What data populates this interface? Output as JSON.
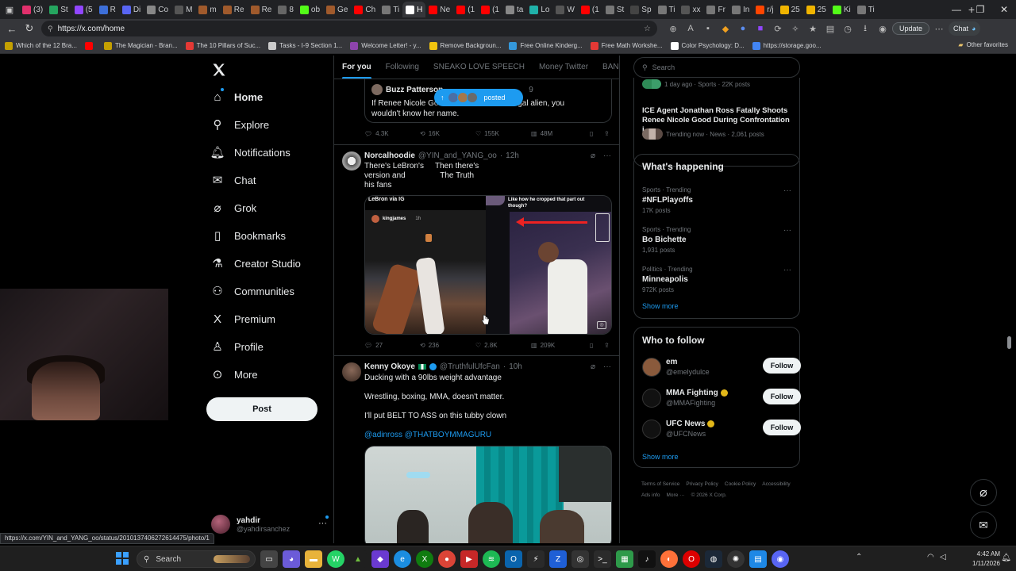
{
  "browser": {
    "tabs": [
      {
        "label": "(3)",
        "color": "#e1306c"
      },
      {
        "label": "St",
        "color": "#25a55f"
      },
      {
        "label": "(5",
        "color": "#9146ff"
      },
      {
        "label": "R",
        "color": "#3d6fd8"
      },
      {
        "label": "Di",
        "color": "#5865f2"
      },
      {
        "label": "Co",
        "color": "#888888"
      },
      {
        "label": "M",
        "color": "#555555"
      },
      {
        "label": "m",
        "color": "#a05a2c"
      },
      {
        "label": "Re",
        "color": "#a05a2c"
      },
      {
        "label": "Re",
        "color": "#a05a2c"
      },
      {
        "label": "8",
        "color": "#666666"
      },
      {
        "label": "ob",
        "color": "#53fc18"
      },
      {
        "label": "Ge",
        "color": "#a05a2c"
      },
      {
        "label": "Ch",
        "color": "#ff0000"
      },
      {
        "label": "Ti",
        "color": "#777777"
      },
      {
        "label": "H",
        "color": "#ffffff"
      },
      {
        "label": "Ne",
        "color": "#ff0000"
      },
      {
        "label": "(1",
        "color": "#ff0000"
      },
      {
        "label": "(1",
        "color": "#ff0000"
      },
      {
        "label": "ta",
        "color": "#888888"
      },
      {
        "label": "Lo",
        "color": "#20b2aa"
      },
      {
        "label": "W",
        "color": "#555555"
      },
      {
        "label": "(1",
        "color": "#ff0000"
      },
      {
        "label": "St",
        "color": "#777777"
      },
      {
        "label": "Sp",
        "color": "#444444"
      },
      {
        "label": "Ti",
        "color": "#777777"
      },
      {
        "label": "xx",
        "color": "#555555"
      },
      {
        "label": "Fr",
        "color": "#777777"
      },
      {
        "label": "In",
        "color": "#777777"
      },
      {
        "label": "r/j",
        "color": "#ff4500"
      },
      {
        "label": "25",
        "color": "#f0b400"
      },
      {
        "label": "25",
        "color": "#f0b400"
      },
      {
        "label": "Ki",
        "color": "#53fc18"
      },
      {
        "label": "Ti",
        "color": "#777777"
      }
    ],
    "url": "https://x.com/home",
    "update_label": "Update",
    "chat_label": "Chat",
    "bookmarks": [
      {
        "label": "Which of the 12 Bra...",
        "color": "#c4a000"
      },
      {
        "label": "",
        "color": "#ff0000"
      },
      {
        "label": "The Magician - Bran...",
        "color": "#c4a000"
      },
      {
        "label": "The 10 Pillars of Suc...",
        "color": "#e53935"
      },
      {
        "label": "Tasks - I-9 Section 1...",
        "color": "#cccccc"
      },
      {
        "label": "Welcome Letter! - y...",
        "color": "#8e44ad"
      },
      {
        "label": "Remove Backgroun...",
        "color": "#f1c40f"
      },
      {
        "label": "Free Online Kinderg...",
        "color": "#3498db"
      },
      {
        "label": "Free Math Workshe...",
        "color": "#e53935"
      },
      {
        "label": "Color Psychology: D...",
        "color": "#ffffff"
      },
      {
        "label": "https://storage.goo...",
        "color": "#4285f4"
      }
    ],
    "other_favorites": "Other favorites",
    "status_url": "https://x.com/YIN_and_YANG_oo/status/2010137406272614475/photo/1"
  },
  "sidebar": {
    "items": [
      {
        "label": "Home",
        "icon": "home-icon"
      },
      {
        "label": "Explore",
        "icon": "search-icon"
      },
      {
        "label": "Notifications",
        "icon": "bell-icon"
      },
      {
        "label": "Chat",
        "icon": "mail-icon"
      },
      {
        "label": "Grok",
        "icon": "grok-icon"
      },
      {
        "label": "Bookmarks",
        "icon": "bookmark-icon"
      },
      {
        "label": "Creator Studio",
        "icon": "flask-icon"
      },
      {
        "label": "Communities",
        "icon": "people-icon"
      },
      {
        "label": "Premium",
        "icon": "x-logo-icon"
      },
      {
        "label": "Profile",
        "icon": "person-icon"
      },
      {
        "label": "More",
        "icon": "more-circle-icon"
      }
    ],
    "post_label": "Post",
    "account": {
      "name": "yahdir",
      "handle": "@yahdirsanchez"
    }
  },
  "feed": {
    "tabs": [
      "For you",
      "Following",
      "SNEAKO LOVE SPEECH",
      "Money Twitter",
      "BANKS IN"
    ],
    "posted_label": "posted",
    "quote": {
      "name": "Buzz Patterson",
      "time": "9",
      "text_a": "If Renee Nicole Goo",
      "text_b": "an illegal alien, you",
      "text_c": "wouldn't know her name."
    },
    "quote_stats": {
      "replies": "4.3K",
      "reposts": "16K",
      "likes": "155K",
      "views": "48M"
    },
    "tweet1": {
      "name": "Norcalhoodie",
      "handle": "@YIN_and_YANG_oo",
      "time": "12h",
      "text_left": "There's LeBron's\nversion and\nhis fans",
      "text_right": "Then there's\nThe Truth",
      "media_caption_left": "LeBron via IG",
      "media_caption_right": "Like how he cropped that part out though?",
      "media_inner_user": "kingjames",
      "media_inner_time": "1h",
      "stats": {
        "replies": "27",
        "reposts": "236",
        "likes": "2.8K",
        "views": "209K"
      }
    },
    "tweet2": {
      "name": "Kenny Okoye",
      "handle": "@TruthfulUfcFan",
      "time": "10h",
      "line1": "Ducking with a 90lbs weight advantage",
      "line2": "Wrestling, boxing, MMA, doesn't matter.",
      "line3": "I'll put BELT TO ASS on this tubby clown",
      "mentions": "@adinross @THATBOYMMAGURU"
    }
  },
  "rail": {
    "search_placeholder": "Search",
    "top_trend_meta": "1 day ago · Sports · 22K posts",
    "news": {
      "title": "ICE Agent Jonathan Ross Fatally Shoots Renee Nicole Good During Confrontation i...",
      "meta": "Trending now · News · 2,061 posts"
    },
    "whats_happening": "What's happening",
    "trends": [
      {
        "meta": "Sports · Trending",
        "name": "#NFLPlayoffs",
        "posts": "17K posts"
      },
      {
        "meta": "Sports · Trending",
        "name": "Bo Bichette",
        "posts": "1,931 posts"
      },
      {
        "meta": "Politics · Trending",
        "name": "Minneapolis",
        "posts": "972K posts"
      }
    ],
    "show_more": "Show more",
    "who_to_follow": "Who to follow",
    "follow_label": "Follow",
    "suggestions": [
      {
        "name": "em",
        "handle": "@emelydulce",
        "color": "#8a5a3c",
        "verified": false
      },
      {
        "name": "MMA Fighting",
        "handle": "@MMAFighting",
        "color": "#111111",
        "verified": true
      },
      {
        "name": "UFC News",
        "handle": "@UFCNews",
        "color": "#111111",
        "verified": true
      }
    ],
    "footer": [
      "Terms of Service",
      "Privacy Policy",
      "Cookie Policy",
      "Accessibility",
      "Ads info",
      "More ···",
      "© 2026 X Corp."
    ]
  },
  "taskbar": {
    "search_label": "Search",
    "time": "4:42 AM",
    "date": "1/11/2026"
  },
  "colors": {
    "accent": "#1d9bf0",
    "bg": "#000000",
    "border": "#2f3336"
  }
}
